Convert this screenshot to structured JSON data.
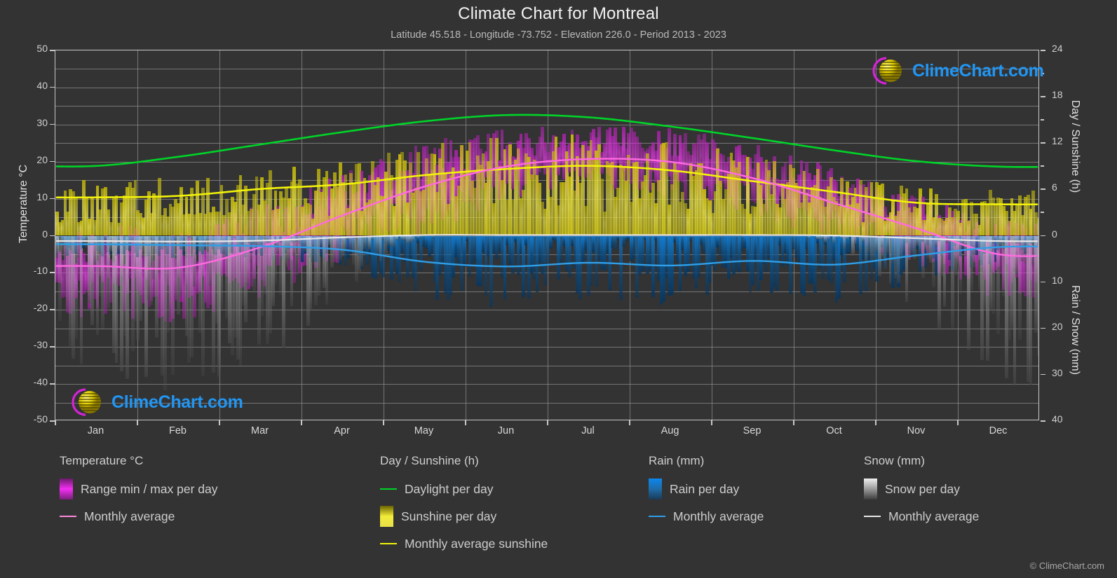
{
  "header": {
    "title": "Climate Chart for Montreal",
    "subtitle": "Latitude 45.518 - Longitude -73.752 - Elevation 226.0 - Period 2013 - 2023"
  },
  "axes": {
    "left_label": "Temperature °C",
    "right_label_top": "Day / Sunshine (h)",
    "right_label_bottom": "Rain / Snow (mm)",
    "left_ticks": [
      "50",
      "40",
      "30",
      "20",
      "10",
      "0",
      "-10",
      "-20",
      "-30",
      "-40",
      "-50"
    ],
    "right_ticks_top": [
      "24",
      "18",
      "12",
      "6",
      "0"
    ],
    "right_ticks_bottom": [
      "0",
      "10",
      "20",
      "30",
      "40"
    ],
    "months": [
      "Jan",
      "Feb",
      "Mar",
      "Apr",
      "May",
      "Jun",
      "Jul",
      "Aug",
      "Sep",
      "Oct",
      "Nov",
      "Dec"
    ]
  },
  "watermark": {
    "text": "ClimeChart.com"
  },
  "legend": {
    "columns": [
      {
        "title": "Temperature °C",
        "items": [
          {
            "label": "Range min / max per day",
            "swatch": "gradient-magenta",
            "type": "box"
          },
          {
            "label": "Monthly average",
            "swatch": "#ff88e0",
            "type": "line"
          }
        ]
      },
      {
        "title": "Day / Sunshine (h)",
        "items": [
          {
            "label": "Daylight per day",
            "swatch": "#00d428",
            "type": "line"
          },
          {
            "label": "Sunshine per day",
            "swatch": "gradient-yellow",
            "type": "box"
          },
          {
            "label": "Monthly average sunshine",
            "swatch": "#f2f20a",
            "type": "line"
          }
        ]
      },
      {
        "title": "Rain (mm)",
        "items": [
          {
            "label": "Rain per day",
            "swatch": "gradient-blue",
            "type": "box"
          },
          {
            "label": "Monthly average",
            "swatch": "#2f9fe8",
            "type": "line"
          }
        ]
      },
      {
        "title": "Snow (mm)",
        "items": [
          {
            "label": "Snow per day",
            "swatch": "gradient-white",
            "type": "box"
          },
          {
            "label": "Monthly average",
            "swatch": "#e8e8e8",
            "type": "line"
          }
        ]
      }
    ]
  },
  "footer": {
    "copyright": "© ClimeChart.com"
  },
  "colors": {
    "background": "#333333",
    "grid": "#8c8c8c",
    "axis": "#c8c8c8",
    "daylight": "#00d428",
    "sunshine_avg": "#f2f20a",
    "temp_avg": "#ff6ae0",
    "rain_avg": "#2f9fe8",
    "snow_avg": "#e8e8e8",
    "temp_range": "#d424d4",
    "rain_bar": "#0d7fd6",
    "snow_bar": "#cfcfcf",
    "brand_blue": "#2196f3",
    "brand_magenta": "#d424d4",
    "brand_yellow": "#d4c800"
  },
  "chart_data": {
    "type": "line",
    "title": "Climate Chart for Montreal",
    "subtitle": "Latitude 45.518 - Longitude -73.752 - Elevation 226.0 - Period 2013 - 2023",
    "xlabel": "",
    "ylabel": "Temperature °C",
    "ylabel_right_top": "Day / Sunshine (h)",
    "ylabel_right_bottom": "Rain / Snow (mm)",
    "categories": [
      "Jan",
      "Feb",
      "Mar",
      "Apr",
      "May",
      "Jun",
      "Jul",
      "Aug",
      "Sep",
      "Oct",
      "Nov",
      "Dec"
    ],
    "ylim": [
      -50,
      50
    ],
    "ylim_right_top": [
      0,
      24
    ],
    "ylim_right_bottom": [
      0,
      40
    ],
    "grid": true,
    "legend_position": "below",
    "series": [
      {
        "name": "Daylight per day",
        "unit": "h",
        "axis": "right-top",
        "color": "#00d428",
        "values": [
          9.0,
          10.2,
          11.8,
          13.4,
          14.8,
          15.6,
          15.3,
          14.1,
          12.6,
          11.0,
          9.6,
          8.9
        ]
      },
      {
        "name": "Monthly average sunshine",
        "unit": "h",
        "axis": "right-top",
        "color": "#f2f20a",
        "values": [
          4.9,
          5.1,
          6.0,
          6.6,
          7.8,
          8.6,
          9.0,
          8.4,
          7.0,
          5.6,
          4.2,
          4.0
        ]
      },
      {
        "name": "Temperature monthly average",
        "unit": "°C",
        "axis": "left",
        "color": "#ff6ae0",
        "values": [
          -8.4,
          -8.8,
          -3.2,
          5.4,
          13.2,
          18.6,
          20.6,
          19.8,
          15.4,
          8.6,
          1.8,
          -5.2
        ]
      },
      {
        "name": "Rain monthly average",
        "unit": "mm",
        "axis": "right-bottom",
        "color": "#2f9fe8",
        "values": [
          2.0,
          2.2,
          2.4,
          3.2,
          5.8,
          6.8,
          6.0,
          6.6,
          5.6,
          6.4,
          4.4,
          2.6
        ]
      },
      {
        "name": "Snow monthly average",
        "unit": "mm",
        "axis": "right-bottom",
        "color": "#e8e8e8",
        "values": [
          1.3,
          1.4,
          1.2,
          0.5,
          0.0,
          0.0,
          0.0,
          0.0,
          0.0,
          0.1,
          0.7,
          1.3
        ]
      }
    ],
    "ranges": [
      {
        "name": "Temperature range min / max per day",
        "unit": "°C",
        "axis": "left",
        "color": "#d424d4",
        "min": [
          -16.5,
          -17.0,
          -10.5,
          -1.5,
          6.5,
          12.5,
          15.5,
          14.5,
          9.5,
          3.0,
          -3.5,
          -12.0
        ],
        "max": [
          -2.0,
          -2.5,
          3.5,
          12.0,
          20.0,
          24.5,
          26.5,
          25.0,
          21.0,
          14.0,
          7.0,
          0.5
        ]
      }
    ]
  }
}
